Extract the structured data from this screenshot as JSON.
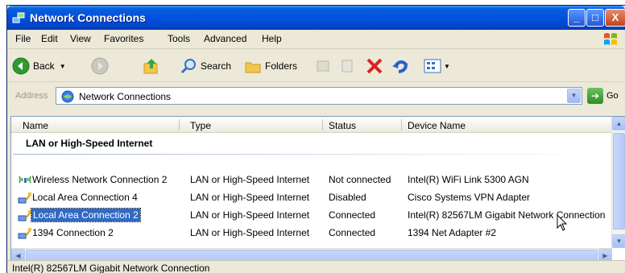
{
  "window": {
    "title": "Network Connections",
    "controls": {
      "minimize": "_",
      "maximize": "□",
      "close": "X"
    }
  },
  "menu": [
    "File",
    "Edit",
    "View",
    "Favorites",
    "Tools",
    "Advanced",
    "Help"
  ],
  "toolbar": {
    "back_label": "Back",
    "search_label": "Search",
    "folders_label": "Folders"
  },
  "address": {
    "label": "Address",
    "value": "Network Connections",
    "go_label": "Go"
  },
  "columns": [
    "Name",
    "Type",
    "Status",
    "Device Name"
  ],
  "group": {
    "title": "LAN or High-Speed Internet"
  },
  "rows": [
    {
      "name": "Wireless Network Connection 2",
      "type": "LAN or High-Speed Internet",
      "status": "Not connected",
      "device": "Intel(R) WiFi Link 5300 AGN",
      "icon": "wireless-icon"
    },
    {
      "name": "Local Area Connection 4",
      "type": "LAN or High-Speed Internet",
      "status": "Disabled",
      "device": "Cisco Systems VPN Adapter",
      "icon": "lan-icon"
    },
    {
      "name": "Local Area Connection 2",
      "type": "LAN or High-Speed Internet",
      "status": "Connected",
      "device": "Intel(R) 82567LM Gigabit Network Connection",
      "icon": "lan-icon",
      "selected": true
    },
    {
      "name": "1394 Connection 2",
      "type": "LAN or High-Speed Internet",
      "status": "Connected",
      "device": "1394 Net Adapter #2",
      "icon": "lan-icon"
    }
  ],
  "statusbar": {
    "text": "Intel(R) 82567LM Gigabit Network Connection"
  },
  "colors": {
    "titlebar": "#0054e3",
    "selection": "#316ac5",
    "chrome": "#ece9d8"
  }
}
